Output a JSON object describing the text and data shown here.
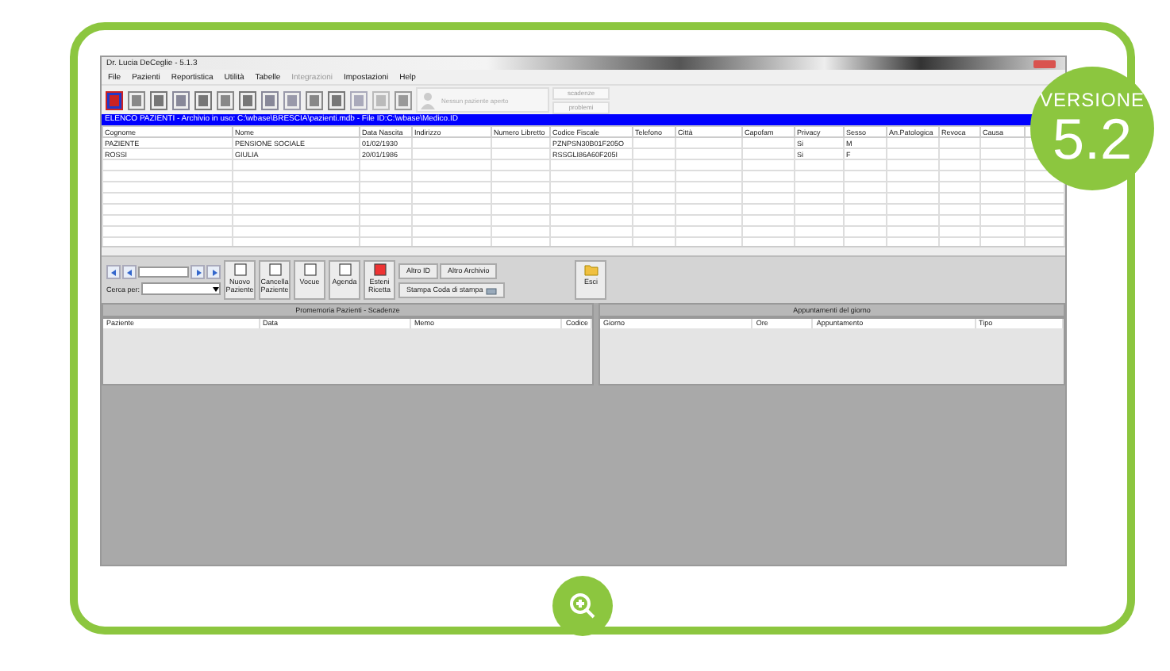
{
  "badge": {
    "label": "VERSIONE",
    "number": "5.2"
  },
  "window": {
    "title": "Dr. Lucia DeCeglie - 5.1.3"
  },
  "menu": [
    {
      "label": "File",
      "disabled": false
    },
    {
      "label": "Pazienti",
      "disabled": false
    },
    {
      "label": "Reportistica",
      "disabled": false
    },
    {
      "label": "Utilità",
      "disabled": false
    },
    {
      "label": "Tabelle",
      "disabled": false
    },
    {
      "label": "Integrazioni",
      "disabled": true
    },
    {
      "label": "Impostazioni",
      "disabled": false
    },
    {
      "label": "Help",
      "disabled": false
    }
  ],
  "toolbar": {
    "patient_status": "Nessun paziente aperto",
    "side_buttons": [
      "scadenze",
      "problemi"
    ]
  },
  "list_title": "ELENCO PAZIENTI - Archivio in uso: C:\\wbase\\BRESCIA\\pazienti.mdb - File ID:C:\\wbase\\Medico.ID",
  "table": {
    "columns": [
      "Cognome",
      "Nome",
      "Data Nascita",
      "Indirizzo",
      "Numero Libretto",
      "Codice Fiscale",
      "Telefono",
      "Città",
      "Capofam",
      "Privacy",
      "Sesso",
      "An.Patologica",
      "Revoca",
      "Causa"
    ],
    "rows": [
      [
        "PAZIENTE",
        "PENSIONE SOCIALE",
        "01/02/1930",
        "",
        "",
        "PZNPSN30B01F205O",
        "",
        "",
        "",
        "Si",
        "M",
        "",
        "",
        ""
      ],
      [
        "ROSSI",
        "GIULIA",
        "20/01/1986",
        "",
        "",
        "RSSGLI86A60F205I",
        "",
        "",
        "",
        "Si",
        "F",
        "",
        "",
        ""
      ]
    ]
  },
  "navigator": {
    "search_label": "Cerca per:"
  },
  "actions": [
    {
      "label": "Nuovo Paziente",
      "kind": "icon"
    },
    {
      "label": "Cancella Paziente",
      "kind": "icon"
    },
    {
      "label": "Vocue",
      "kind": "icon"
    },
    {
      "label": "Agenda",
      "kind": "icon"
    },
    {
      "label": "Esteni Ricetta",
      "kind": "icon"
    }
  ],
  "archive_buttons": [
    "Altro ID",
    "Altro Archivio"
  ],
  "print_button": "Stampa Coda di stampa",
  "exit_button": "Esci",
  "panels": [
    {
      "title": "Promemoria Pazienti - Scadenze",
      "columns": [
        "Paziente",
        "Data",
        "Memo",
        "Codice"
      ]
    },
    {
      "title": "Appuntamenti del giorno",
      "columns": [
        "Giorno",
        "Ore",
        "Appuntamento",
        "Tipo"
      ]
    }
  ]
}
